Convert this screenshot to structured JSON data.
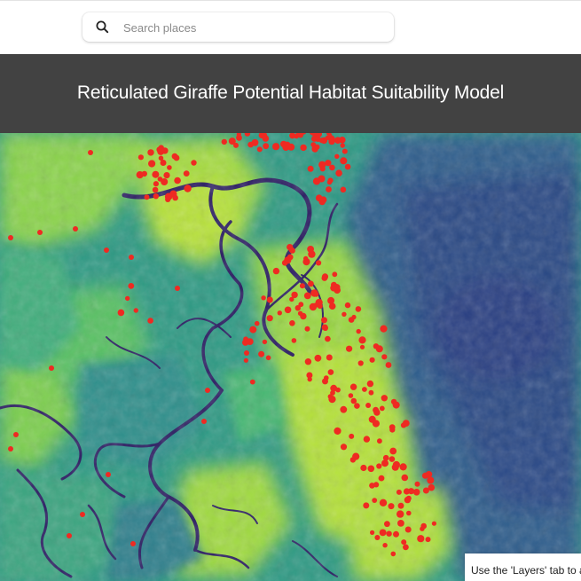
{
  "search": {
    "placeholder": "Search places",
    "icon": "search-icon"
  },
  "header": {
    "title": "Reticulated Giraffe Potential Habitat Suitability Model"
  },
  "map": {
    "layer": "habitat-suitability",
    "palette": {
      "high": "#b6e43c",
      "mid": "#32b679",
      "low": "#30558e",
      "lowest": "#2c1a5e"
    },
    "occurrence_color": "#ee2a22"
  },
  "status": {
    "text": "Use the 'Layers' tab to a"
  }
}
